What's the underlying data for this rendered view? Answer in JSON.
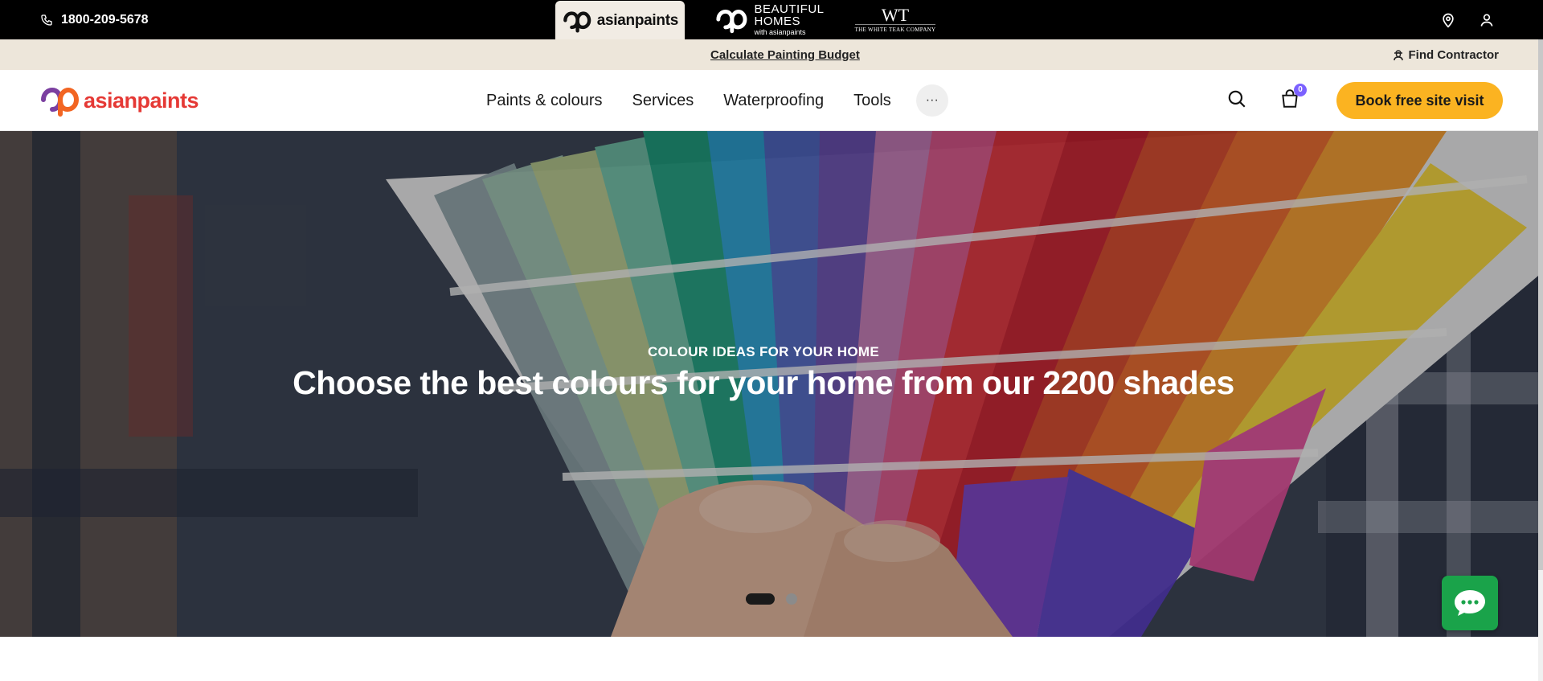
{
  "topbar": {
    "phone": "1800-209-5678",
    "brands": [
      {
        "name": "asianpaints",
        "active": true
      },
      {
        "line1": "BEAUTIFUL",
        "line2": "HOMES",
        "line3": "with asianpaints"
      },
      {
        "monogram": "WT",
        "name": "THE WHITE TEAK COMPANY"
      }
    ],
    "icons": [
      "location-pin-icon",
      "user-icon"
    ]
  },
  "utilbar": {
    "budget_link": "Calculate Painting Budget",
    "contractor_link": "Find Contractor"
  },
  "navbar": {
    "logo_text": "asianpaints",
    "items": [
      "Paints & colours",
      "Services",
      "Waterproofing",
      "Tools"
    ],
    "more_label": "···",
    "cart_count": "0",
    "book_button": "Book free site visit"
  },
  "hero": {
    "eyebrow": "COLOUR IDEAS FOR YOUR HOME",
    "headline": "Choose the best colours for your home from our 2200 shades",
    "slides": 2,
    "active_slide": 1
  },
  "colors": {
    "topbar_bg": "#000000",
    "utilbar_bg": "#ede6da",
    "brand_red": "#e53935",
    "cta_yellow": "#fbb321",
    "cart_badge": "#7b61ff",
    "chat_green": "#1aa34a"
  }
}
